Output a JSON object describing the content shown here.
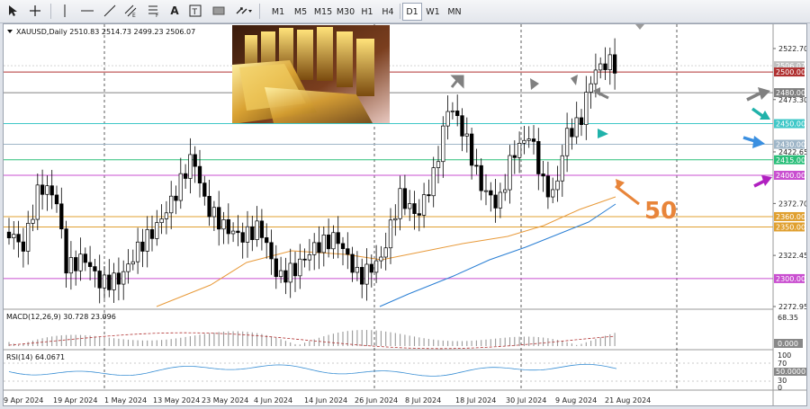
{
  "toolbar": {
    "timeframes": [
      "M1",
      "M5",
      "M15",
      "M30",
      "H1",
      "H4",
      "D1",
      "W1",
      "MN"
    ],
    "active_timeframe": "D1",
    "text_tool_label": "A"
  },
  "chart_info": {
    "symbol_line": "XAUUSD,Daily  2510.83 2514.73 2499.23 2506.07",
    "big_label": "50"
  },
  "price_axis": {
    "ticks": [
      "2522.70",
      "2473.30",
      "2422.65",
      "2372.70",
      "2322.45",
      "2272.95"
    ],
    "line_labels": [
      {
        "text": "2506.07",
        "price": 2506.07,
        "kind": "current",
        "color": "#c0c0c0"
      },
      {
        "text": "2500.00",
        "price": 2500,
        "kind": "level",
        "color": "#b03030"
      },
      {
        "text": "2480.00",
        "price": 2480,
        "kind": "level",
        "color": "#808080"
      },
      {
        "text": "2450.00",
        "price": 2450,
        "kind": "level",
        "color": "#40c8c8"
      },
      {
        "text": "2430.00",
        "price": 2430,
        "kind": "level",
        "color": "#9fb6c8"
      },
      {
        "text": "2415.00",
        "price": 2415,
        "kind": "level",
        "color": "#2bbf7a"
      },
      {
        "text": "2400.00",
        "price": 2400,
        "kind": "level",
        "color": "#c94fd0"
      },
      {
        "text": "2360.00",
        "price": 2360,
        "kind": "level",
        "color": "#e0a030"
      },
      {
        "text": "2350.00",
        "price": 2350,
        "kind": "level",
        "color": "#e0a030"
      },
      {
        "text": "2300.00",
        "price": 2300,
        "kind": "level",
        "color": "#c94fd0"
      }
    ]
  },
  "macd": {
    "label": "MACD(12,26,9) 30.728 23.096",
    "top_tick": "68.35",
    "zero_tick": "0.000"
  },
  "rsi": {
    "label": "RSI(14) 64.0671",
    "ticks": [
      "100",
      "70",
      "50.0000",
      "30",
      "0"
    ]
  },
  "date_axis": [
    "9 Apr 2024",
    "19 Apr 2024",
    "1 May 2024",
    "13 May 2024",
    "23 May 2024",
    "4 Jun 2024",
    "14 Jun 2024",
    "26 Jun 2024",
    "8 Jul 2024",
    "18 Jul 2024",
    "30 Jul 2024",
    "9 Aug 2024",
    "21 Aug 2024"
  ],
  "colors": {
    "up": "#ffffff",
    "down": "#000000",
    "ma_fast": "#e89a3a",
    "ma_slow": "#2a7fd4",
    "annotation_orange": "#e8853a",
    "arrow_gray": "#808080",
    "arrow_teal": "#20b2aa",
    "arrow_blue": "#3a8fe0",
    "arrow_purple": "#b020c0"
  }
}
